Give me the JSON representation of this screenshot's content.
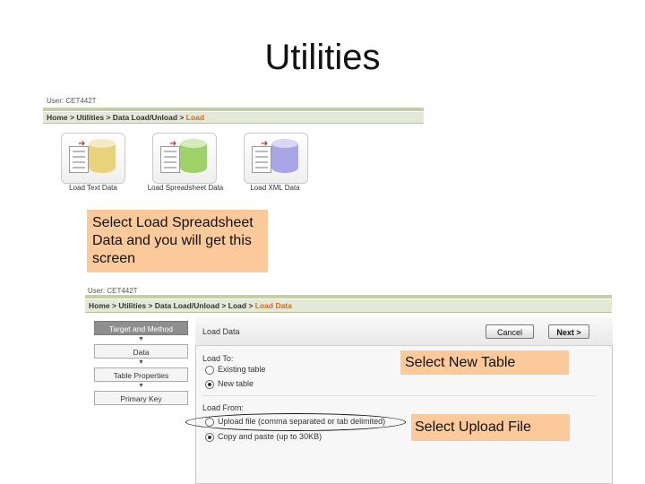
{
  "slide": {
    "title": "Utilities"
  },
  "top_screen": {
    "user": "User: CET442T",
    "breadcrumb": [
      "Home",
      "Utilities",
      "Data Load/Unload",
      "Load"
    ],
    "separator": ">",
    "tiles": [
      {
        "label": "Load Text Data",
        "icon": "database-icon",
        "color": "#e8d27a"
      },
      {
        "label": "Load Spreadsheet Data",
        "icon": "database-icon",
        "color": "#9fd36a"
      },
      {
        "label": "Load XML Data",
        "icon": "database-icon",
        "color": "#a9a6e8"
      }
    ]
  },
  "callouts": {
    "select_load": "Select Load Spreadsheet Data and you will get this screen",
    "new_table": "Select New Table",
    "upload_file": "Select Upload File"
  },
  "bottom_screen": {
    "user": "User: CET442T",
    "breadcrumb": [
      "Home",
      "Utilities",
      "Data Load/Unload",
      "Load",
      "Load Data"
    ],
    "separator": ">",
    "steps": [
      "Target and Method",
      "Data",
      "Table Properties",
      "Primary Key"
    ],
    "step_arrow": "▼",
    "panel_title": "Load Data",
    "buttons": {
      "cancel": "Cancel",
      "next": "Next >"
    },
    "load_to": {
      "label": "Load To:",
      "options": [
        {
          "text": "Existing table",
          "selected": false
        },
        {
          "text": "New table",
          "selected": true
        }
      ]
    },
    "load_from": {
      "label": "Load From:",
      "options": [
        {
          "text": "Upload file (comma separated or tab delimited)",
          "selected": false
        },
        {
          "text": "Copy and paste (up to 30KB)",
          "selected": true
        }
      ]
    }
  }
}
